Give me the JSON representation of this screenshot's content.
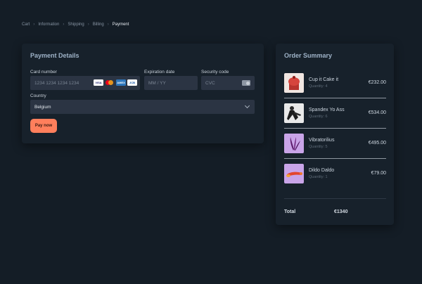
{
  "breadcrumb": [
    "Cart",
    "Information",
    "Shipping",
    "Billing",
    "Payment"
  ],
  "payment": {
    "title": "Payment Details",
    "card_number_label": "Card number",
    "card_number_placeholder": "1234 1234 1234 1234",
    "card_logos": [
      "VISA",
      "",
      "AMEX",
      "JCB"
    ],
    "expiry_label": "Expiration date",
    "expiry_placeholder": "MM / YY",
    "cvc_label": "Security code",
    "cvc_placeholder": "CVC",
    "country_label": "Country",
    "country_value": "Belgium",
    "pay_button": "Pay now"
  },
  "summary": {
    "title": "Order Summary",
    "items": [
      {
        "name": "Cup it Cake it",
        "qty": "Quantity: 4",
        "price": "€232.00"
      },
      {
        "name": "Spandex Yo Ass",
        "qty": "Quantity: 6",
        "price": "€534.00"
      },
      {
        "name": "Vibratorilius",
        "qty": "Quantity: 5",
        "price": "€495.00"
      },
      {
        "name": "Dildo Daldo",
        "qty": "Quantity: 1",
        "price": "€79.00"
      }
    ],
    "total_label": "Total",
    "total_value": "€1340"
  },
  "colors": {
    "background": "#141d26",
    "card": "#17212b",
    "field": "#2b3443",
    "accent": "#ff7f5c"
  }
}
